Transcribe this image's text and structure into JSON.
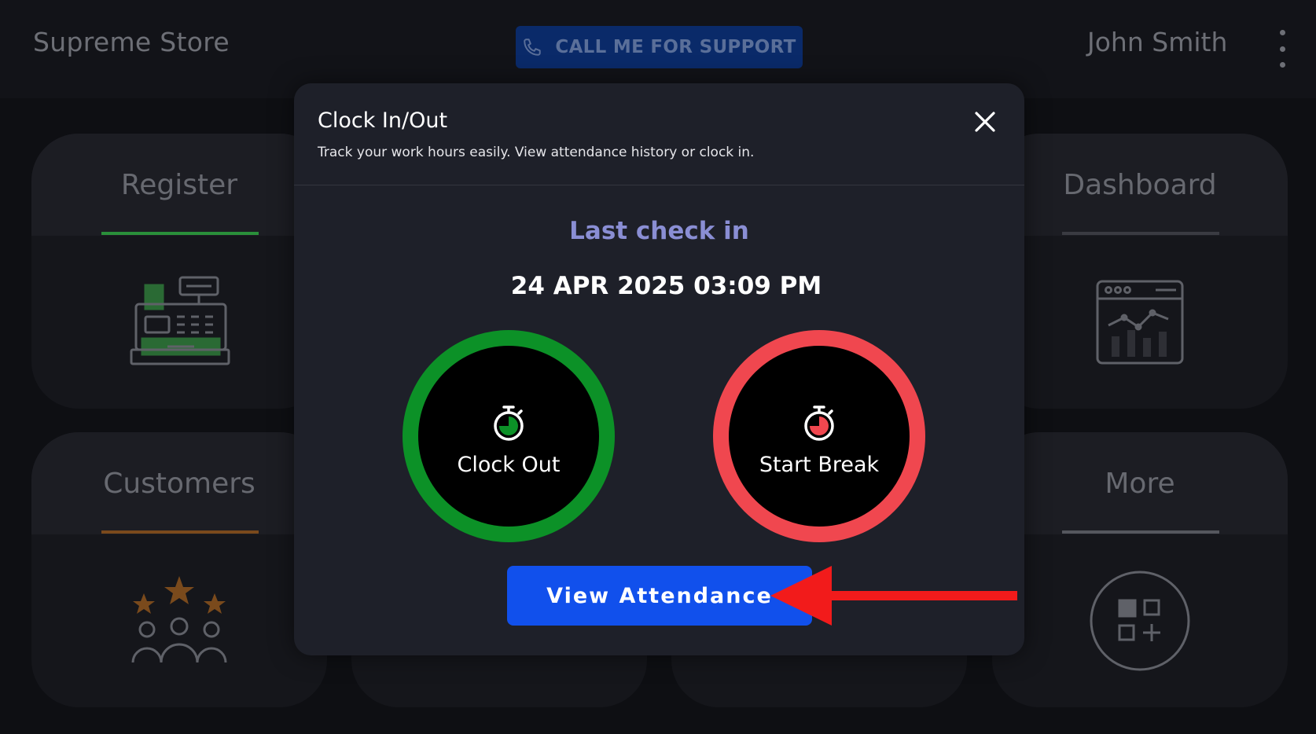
{
  "topbar": {
    "store_name": "Supreme Store",
    "support_label": "CALL ME FOR SUPPORT",
    "support_icon": "phone-icon",
    "user_name": "John Smith",
    "menu_icon": "kebab-menu-icon"
  },
  "tiles": {
    "register": {
      "label": "Register",
      "accent": "#2a8f3a",
      "icon": "cash-register-icon"
    },
    "dashboard": {
      "label": "Dashboard",
      "accent": "#3a3b42",
      "icon": "analytics-window-icon"
    },
    "customers": {
      "label": "Customers",
      "accent": "#7a4a1c",
      "icon": "customer-rating-icon"
    },
    "more": {
      "label": "More",
      "accent": "#55575e",
      "icon": "apps-add-icon"
    }
  },
  "modal": {
    "title": "Clock In/Out",
    "subtitle": "Track your work hours easily. View attendance history or clock in.",
    "close_icon": "close-icon",
    "last_check_label": "Last check in",
    "last_check_value": "24 APR 2025 03:09 PM",
    "clock_out_label": "Clock Out",
    "clock_out_color": "#0c9127",
    "start_break_label": "Start Break",
    "start_break_color": "#f0474f",
    "view_attendance_label": "View Attendance"
  },
  "annotation": {
    "arrow_color": "#f21b1b",
    "arrow_icon": "pointer-arrow-icon"
  }
}
